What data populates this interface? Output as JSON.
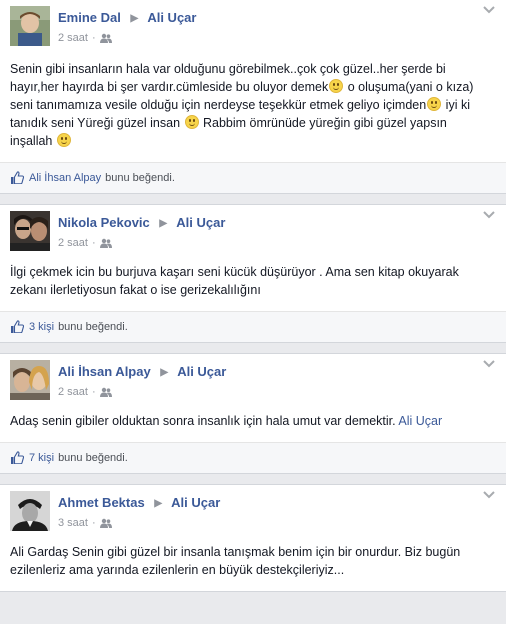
{
  "posts": [
    {
      "author": "Emine Dal",
      "target": "Ali Uçar",
      "time": "2 saat",
      "body": [
        {
          "t": "text",
          "v": "Senin gibi insanların hala var olduğunu görebilmek..çok çok güzel..her şerde bi hayır,her hayırda bi şer vardır.cümleside bu oluyor demek"
        },
        {
          "t": "emoji"
        },
        {
          "t": "text",
          "v": " o oluşuma(yani o kıza) seni tanımamıza vesile olduğu için nerdeyse teşekkür etmek geliyo içimden"
        },
        {
          "t": "emoji"
        },
        {
          "t": "text",
          "v": " iyi ki tanıdık seni Yüreği güzel insan "
        },
        {
          "t": "emoji"
        },
        {
          "t": "text",
          "v": " Rabbim ömrünüde yüreğin gibi güzel yapsın inşallah "
        },
        {
          "t": "emoji"
        }
      ],
      "likes_link": "Ali İhsan Alpay",
      "likes_suffix": "bunu beğendi."
    },
    {
      "author": "Nikola Pekovic",
      "target": "Ali Uçar",
      "time": "2 saat",
      "body": [
        {
          "t": "text",
          "v": "İlgi çekmek icin bu burjuva kaşarı seni kücük düşürüyor . Ama sen kitap okuyarak zekanı ilerletiyosun fakat o ise gerizekalılığını"
        }
      ],
      "likes_link": "3 kişi",
      "likes_suffix": "bunu beğendi."
    },
    {
      "author": "Ali İhsan Alpay",
      "target": "Ali Uçar",
      "time": "2 saat",
      "body": [
        {
          "t": "text",
          "v": "Adaş senin gibiler olduktan sonra insanlık için hala umut var demektir. "
        },
        {
          "t": "link",
          "v": "Ali Uçar"
        }
      ],
      "likes_link": "7 kişi",
      "likes_suffix": "bunu beğendi."
    },
    {
      "author": "Ahmet Bektas",
      "target": "Ali Uçar",
      "time": "3 saat",
      "body": [
        {
          "t": "text",
          "v": "Ali Gardaş Senin gibi güzel bir insanla tanışmak benim için bir onurdur. Biz bugün ezilenleriz ama yarında ezilenlerin en büyük destekçileriyiz..."
        }
      ],
      "likes_link": "",
      "likes_suffix": ""
    }
  ],
  "ui": {
    "separator_arrow": "▶",
    "meta_dot": "·",
    "accent_color": "#3b5998",
    "icons": [
      "friends-icon",
      "chevron-down-icon",
      "like-thumb-icon",
      "smiley-emoji-icon"
    ]
  }
}
